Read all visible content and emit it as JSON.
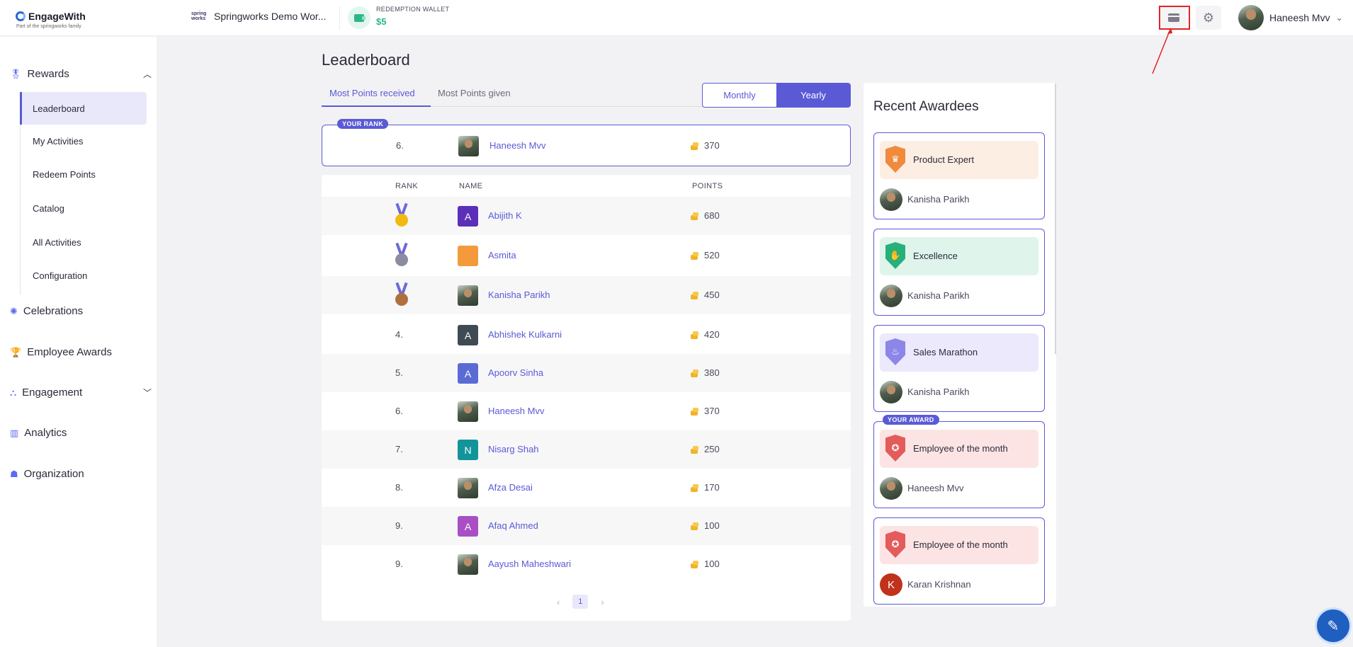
{
  "topbar": {
    "logo_name": "EngageWith",
    "logo_sub": "Part of the springworks family",
    "workspace_logo": "spring works",
    "workspace_name": "Springworks Demo Wor...",
    "wallet_label": "REDEMPTION WALLET",
    "wallet_amount": "$5",
    "user_name": "Haneesh Mvv",
    "icons": [
      "card-icon",
      "gear-icon",
      "chevron-down-icon"
    ]
  },
  "sidebar": {
    "rewards": "Rewards",
    "sub_items": [
      "Leaderboard",
      "My Activities",
      "Redeem Points",
      "Catalog",
      "All Activities",
      "Configuration"
    ],
    "active": "Leaderboard",
    "celebrations": "Celebrations",
    "employee_awards": "Employee Awards",
    "engagement": "Engagement",
    "analytics": "Analytics",
    "organization": "Organization"
  },
  "main": {
    "title": "Leaderboard",
    "tabs": [
      "Most Points received",
      "Most Points given"
    ],
    "active_tab": "Most Points received",
    "period_toggle": [
      "Monthly",
      "Yearly"
    ],
    "active_period": "Yearly",
    "your_rank": {
      "badge": "YOUR RANK",
      "rank": "6.",
      "name": "Haneesh Mvv",
      "points": "370"
    },
    "columns": [
      "RANK",
      "NAME",
      "POINTS"
    ],
    "rows": [
      {
        "rank": "",
        "medal": "gold",
        "initial": "A",
        "avatar_color": "#5b2fb8",
        "name": "Abijith K",
        "points": "680"
      },
      {
        "rank": "",
        "medal": "silver",
        "initial": "",
        "avatar_color": "#f39a3d",
        "name": "Asmita",
        "points": "520"
      },
      {
        "rank": "",
        "medal": "bronze",
        "initial": "",
        "avatar_color": "photo",
        "name": "Kanisha Parikh",
        "points": "450"
      },
      {
        "rank": "4.",
        "medal": "",
        "initial": "A",
        "avatar_color": "#3f4a54",
        "name": "Abhishek Kulkarni",
        "points": "420"
      },
      {
        "rank": "5.",
        "medal": "",
        "initial": "A",
        "avatar_color": "#5a6cd4",
        "name": "Apoorv Sinha",
        "points": "380"
      },
      {
        "rank": "6.",
        "medal": "",
        "initial": "",
        "avatar_color": "photo",
        "name": "Haneesh Mvv",
        "points": "370"
      },
      {
        "rank": "7.",
        "medal": "",
        "initial": "N",
        "avatar_color": "#12949a",
        "name": "Nisarg Shah",
        "points": "250"
      },
      {
        "rank": "8.",
        "medal": "",
        "initial": "",
        "avatar_color": "photo",
        "name": "Afza Desai",
        "points": "170"
      },
      {
        "rank": "9.",
        "medal": "",
        "initial": "A",
        "avatar_color": "#a84fc4",
        "name": "Afaq Ahmed",
        "points": "100"
      },
      {
        "rank": "9.",
        "medal": "",
        "initial": "",
        "avatar_color": "photo",
        "name": "Aayush Maheshwari",
        "points": "100"
      }
    ],
    "pagination": {
      "prev": "‹",
      "page": "1",
      "next": "›"
    }
  },
  "awardees": {
    "title": "Recent Awardees",
    "items": [
      {
        "award": "Product Expert",
        "person": "Kanisha Parikh",
        "banner": "#fdeee3",
        "shield": "#f08a3c",
        "glyph": "♛",
        "badge": "",
        "initial": ""
      },
      {
        "award": "Excellence",
        "person": "Kanisha Parikh",
        "banner": "#dff5ec",
        "shield": "#27b07a",
        "glyph": "✋",
        "badge": "",
        "initial": ""
      },
      {
        "award": "Sales Marathon",
        "person": "Kanisha Parikh",
        "banner": "#ebe9fb",
        "shield": "#8c86e8",
        "glyph": "♨",
        "badge": "",
        "initial": ""
      },
      {
        "award": "Employee of the month",
        "person": "Haneesh Mvv",
        "banner": "#fde4e4",
        "shield": "#e35b5b",
        "glyph": "✪",
        "badge": "YOUR AWARD",
        "initial": ""
      },
      {
        "award": "Employee of the month",
        "person": "Karan Krishnan",
        "banner": "#fde4e4",
        "shield": "#e35b5b",
        "glyph": "✪",
        "badge": "",
        "initial": "K"
      }
    ]
  },
  "colors": {
    "accent": "#5a5ad6",
    "wallet": "#2fb58a",
    "highlight": "#e02424"
  }
}
